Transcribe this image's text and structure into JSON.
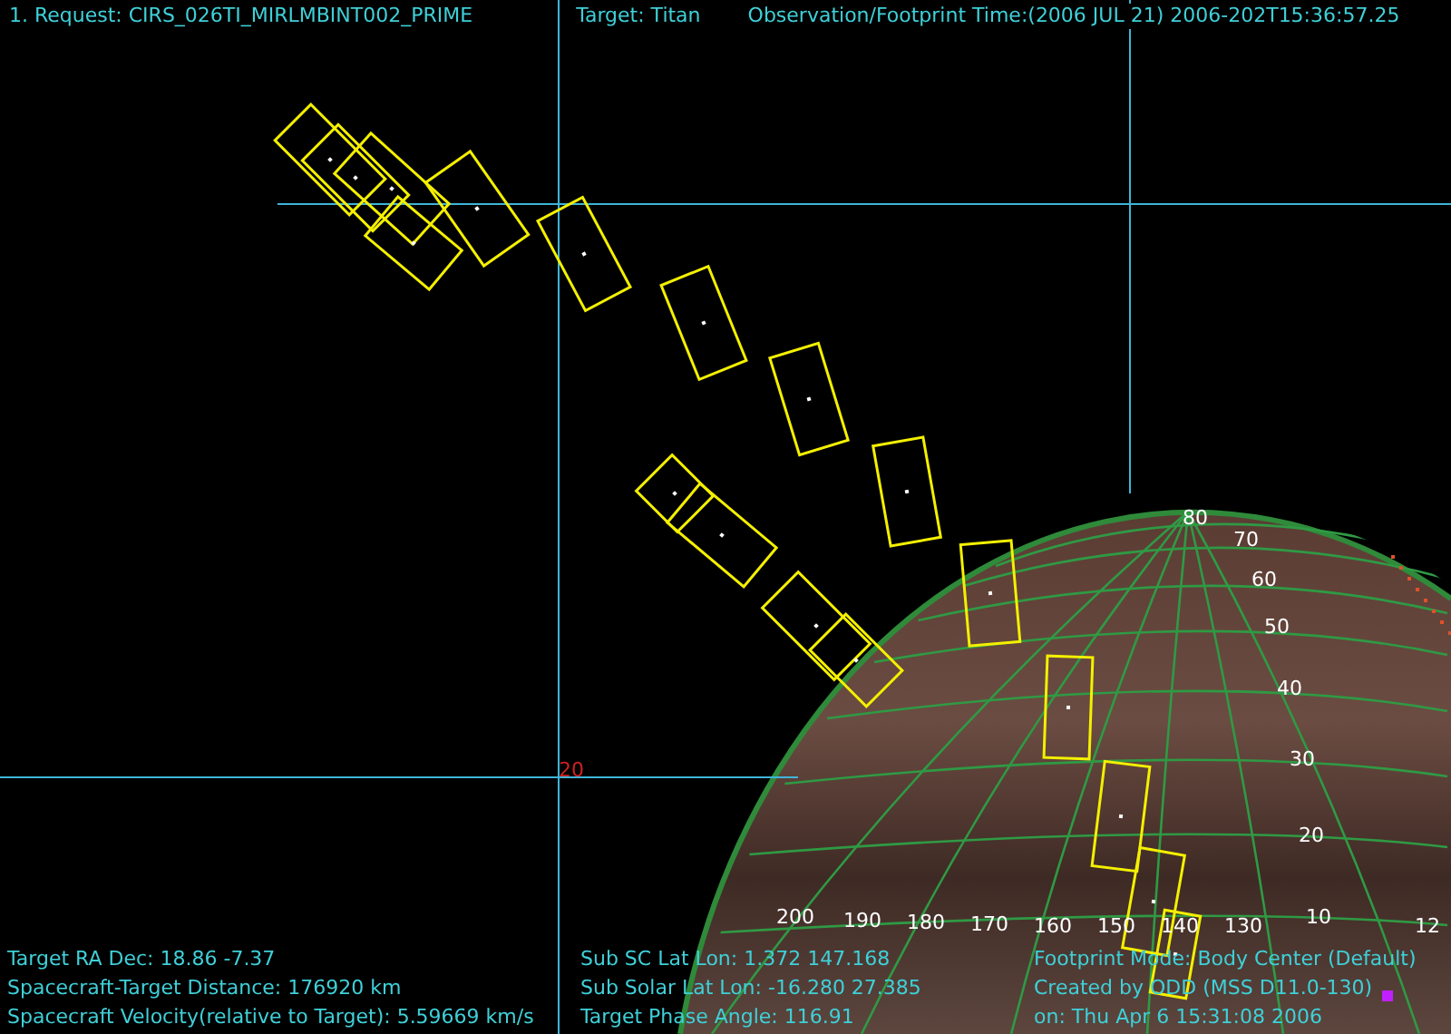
{
  "header": {
    "request": "1. Request:  CIRS_026TI_MIRLMBINT002_PRIME",
    "target": "Target: Titan",
    "time": "Observation/Footprint Time:(2006 JUL 21) 2006-202T15:36:57.25"
  },
  "grid_label": "20",
  "latitude_labels": [
    "80",
    "70",
    "60",
    "50",
    "40",
    "30",
    "20",
    "10"
  ],
  "longitude_labels": [
    "200",
    "190",
    "180",
    "170",
    "160",
    "150",
    "140",
    "130",
    "12"
  ],
  "footer": [
    [
      "Target RA  Dec: 18.86   -7.37",
      "Spacecraft-Target Distance:  176920 km",
      "Spacecraft Velocity(relative to Target): 5.59669 km/s"
    ],
    [
      "Sub SC Lat Lon:  1.372  147.168",
      "Sub Solar Lat Lon: -16.280  27.385",
      "Target Phase Angle: 116.91"
    ],
    [
      "Footprint Mode: Body Center (Default)",
      "Created by ODD (MSS D11.0-130)",
      "on: Thu Apr  6 15:31:08 2006"
    ]
  ]
}
